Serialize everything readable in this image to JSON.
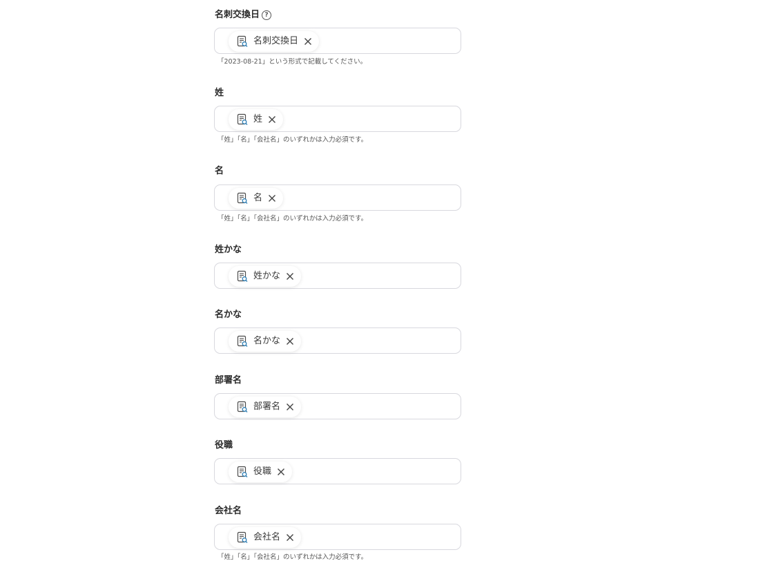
{
  "fields": [
    {
      "label": "名刺交換日",
      "chip": "名刺交換日",
      "hint": "「2023-08-21」という形式で記載してください。",
      "has_help_icon": true
    },
    {
      "label": "姓",
      "chip": "姓",
      "hint": "「姓」「名」「会社名」のいずれかは入力必須です。"
    },
    {
      "label": "名",
      "chip": "名",
      "hint": "「姓」「名」「会社名」のいずれかは入力必須です。"
    },
    {
      "label": "姓かな",
      "chip": "姓かな",
      "hint": ""
    },
    {
      "label": "名かな",
      "chip": "名かな",
      "hint": ""
    },
    {
      "label": "部署名",
      "chip": "部署名",
      "hint": ""
    },
    {
      "label": "役職",
      "chip": "役職",
      "hint": ""
    },
    {
      "label": "会社名",
      "chip": "会社名",
      "hint": "「姓」「名」「会社名」のいずれかは入力必須です。"
    }
  ],
  "icons": {
    "help": "question-circle-icon",
    "chip": "document-search-icon",
    "remove": "close-icon"
  },
  "colors": {
    "icon_accent": "#2f7fb5",
    "border": "#d8d8de",
    "label": "#2b2b2b",
    "hint": "#555555"
  },
  "help_glyph": "?"
}
